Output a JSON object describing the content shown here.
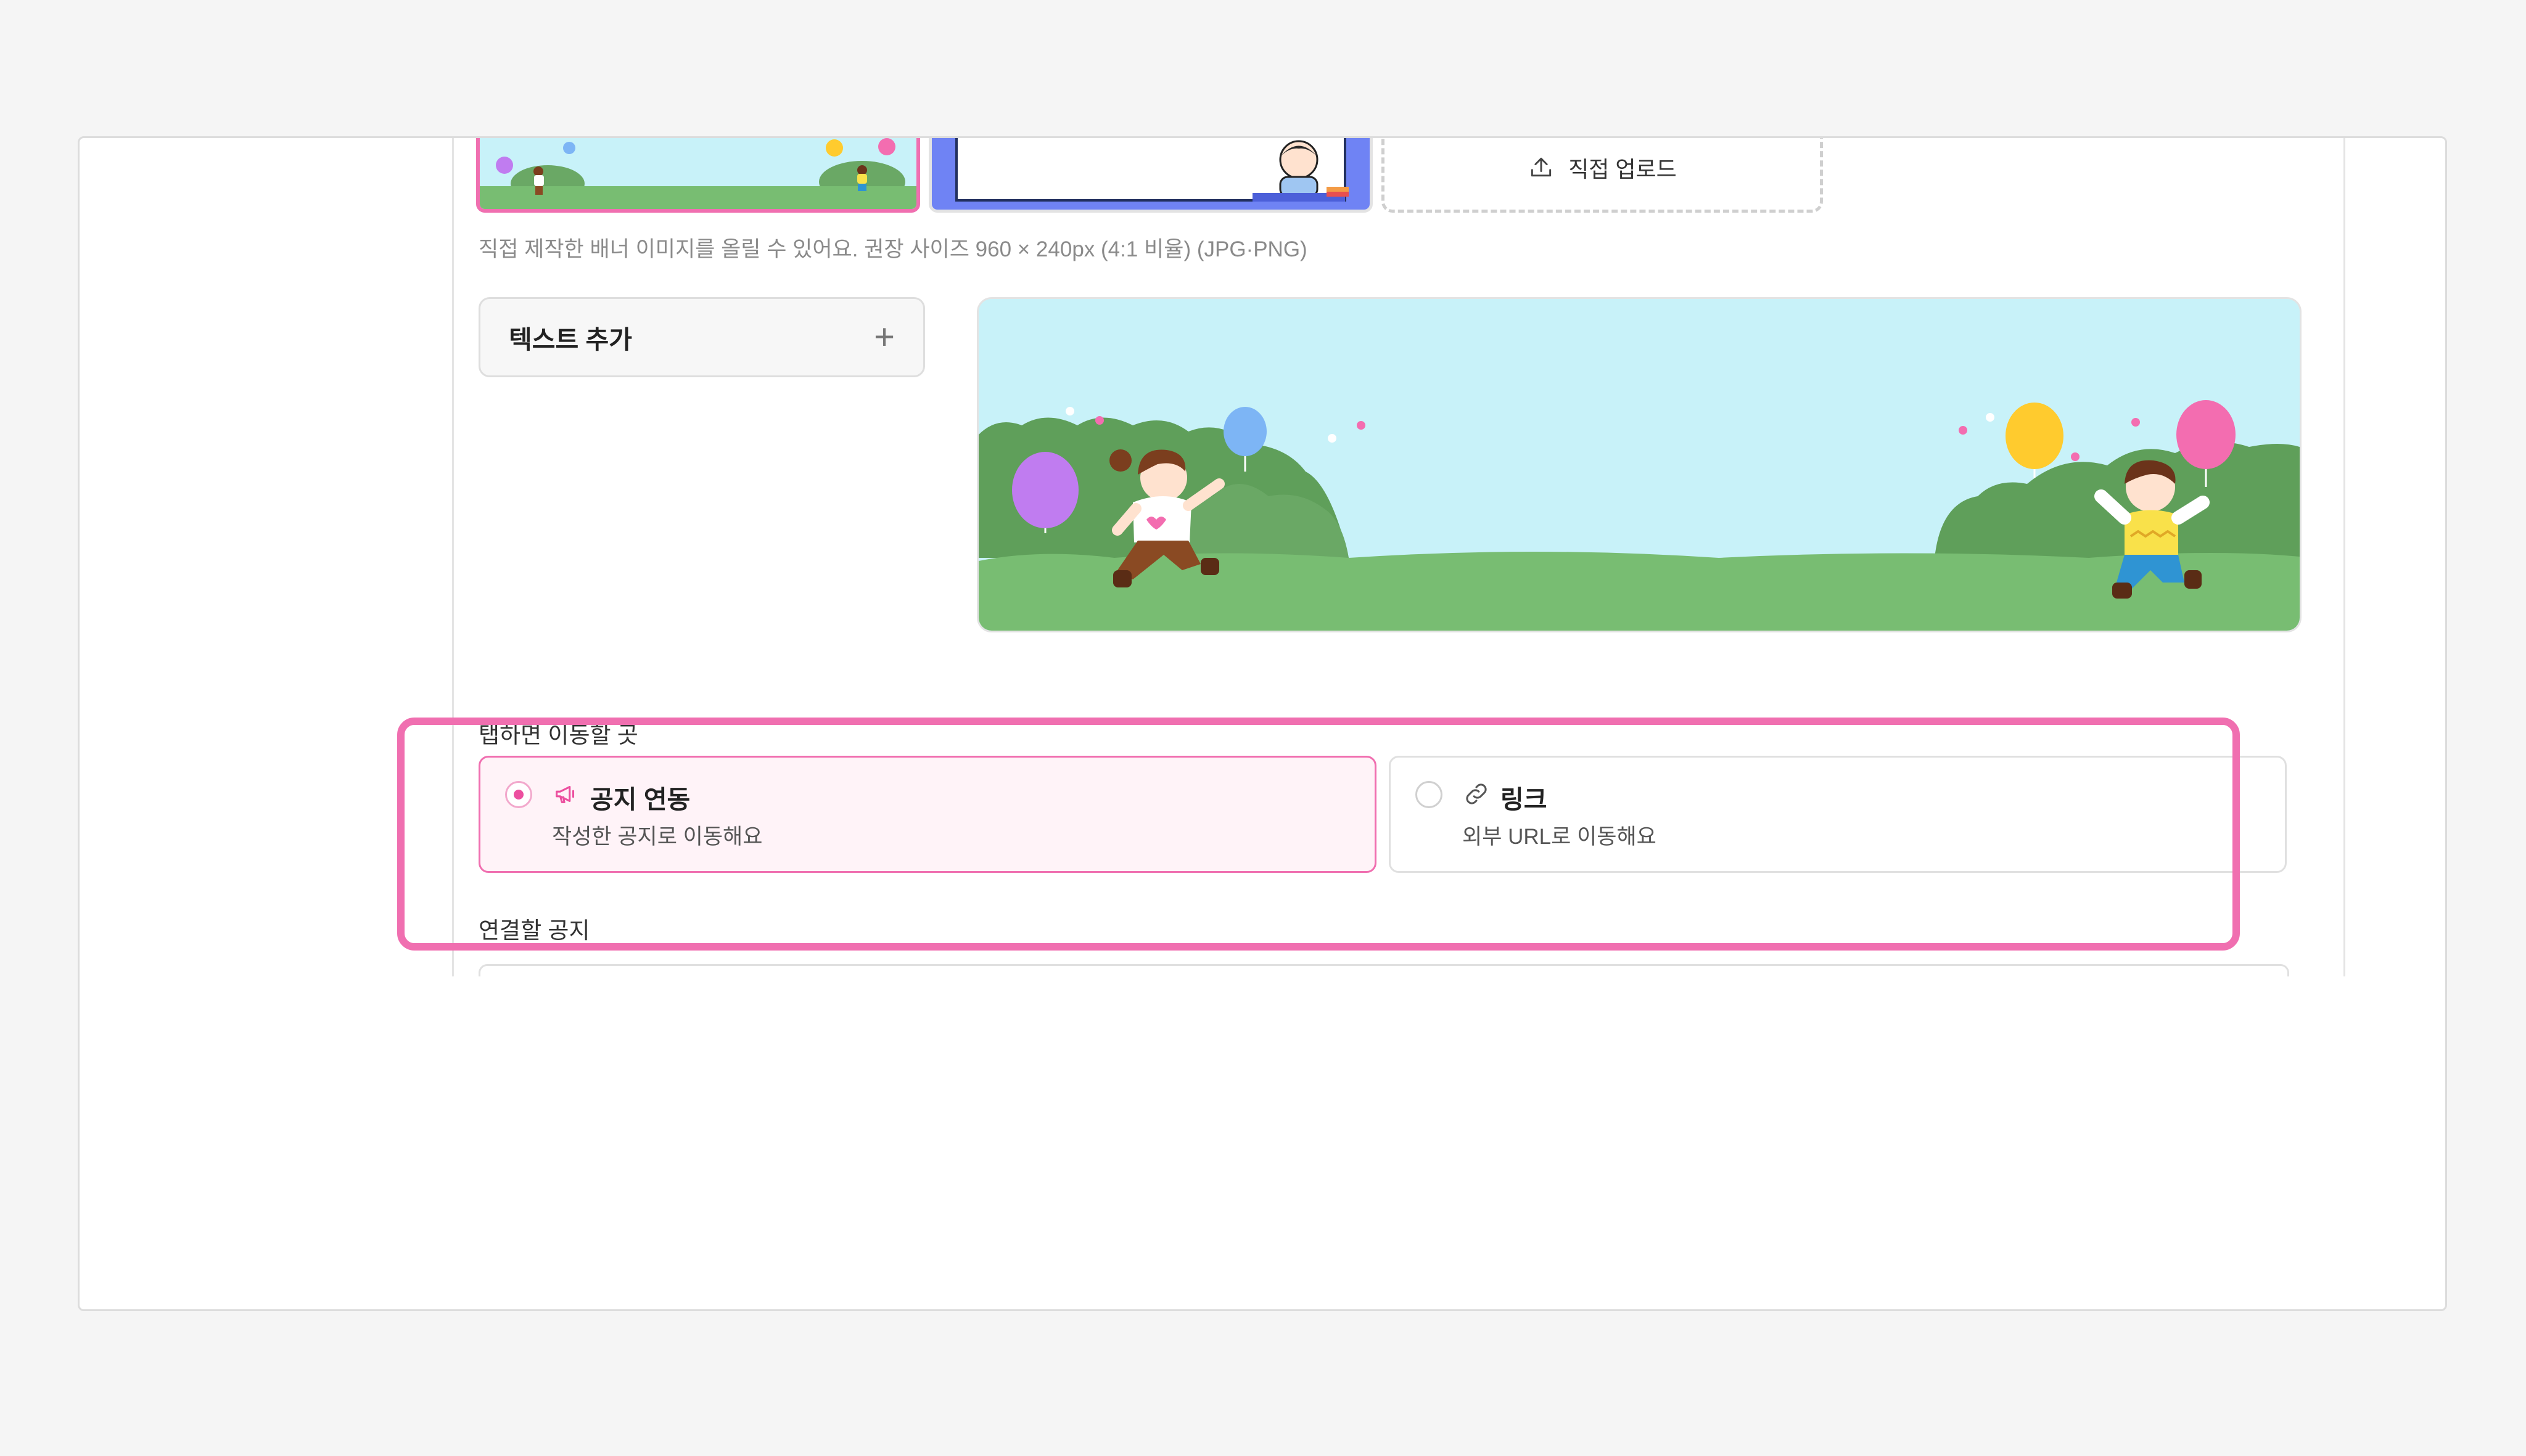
{
  "upload": {
    "direct_upload_label": "직접 업로드",
    "hint": "직접 제작한 배너 이미지를 올릴 수 있어요. 권장 사이즈 960 × 240px (4:1 비율) (JPG·PNG)"
  },
  "text_panel": {
    "add_text_label": "텍스트 추가",
    "plus_symbol": "+"
  },
  "link_section": {
    "label": "탭하면 이동할 곳",
    "options": [
      {
        "title": "공지 연동",
        "description": "작성한 공지로 이동해요",
        "selected": true,
        "icon": "megaphone-icon"
      },
      {
        "title": "링크",
        "description": "외부 URL로 이동해요",
        "selected": false,
        "icon": "link-icon"
      }
    ],
    "notice_label": "연결할 공지"
  },
  "colors": {
    "accent": "#f06fb0",
    "sky": "#c8f2f9",
    "grass": "#78bd72",
    "bush": "#5f9f5a"
  }
}
